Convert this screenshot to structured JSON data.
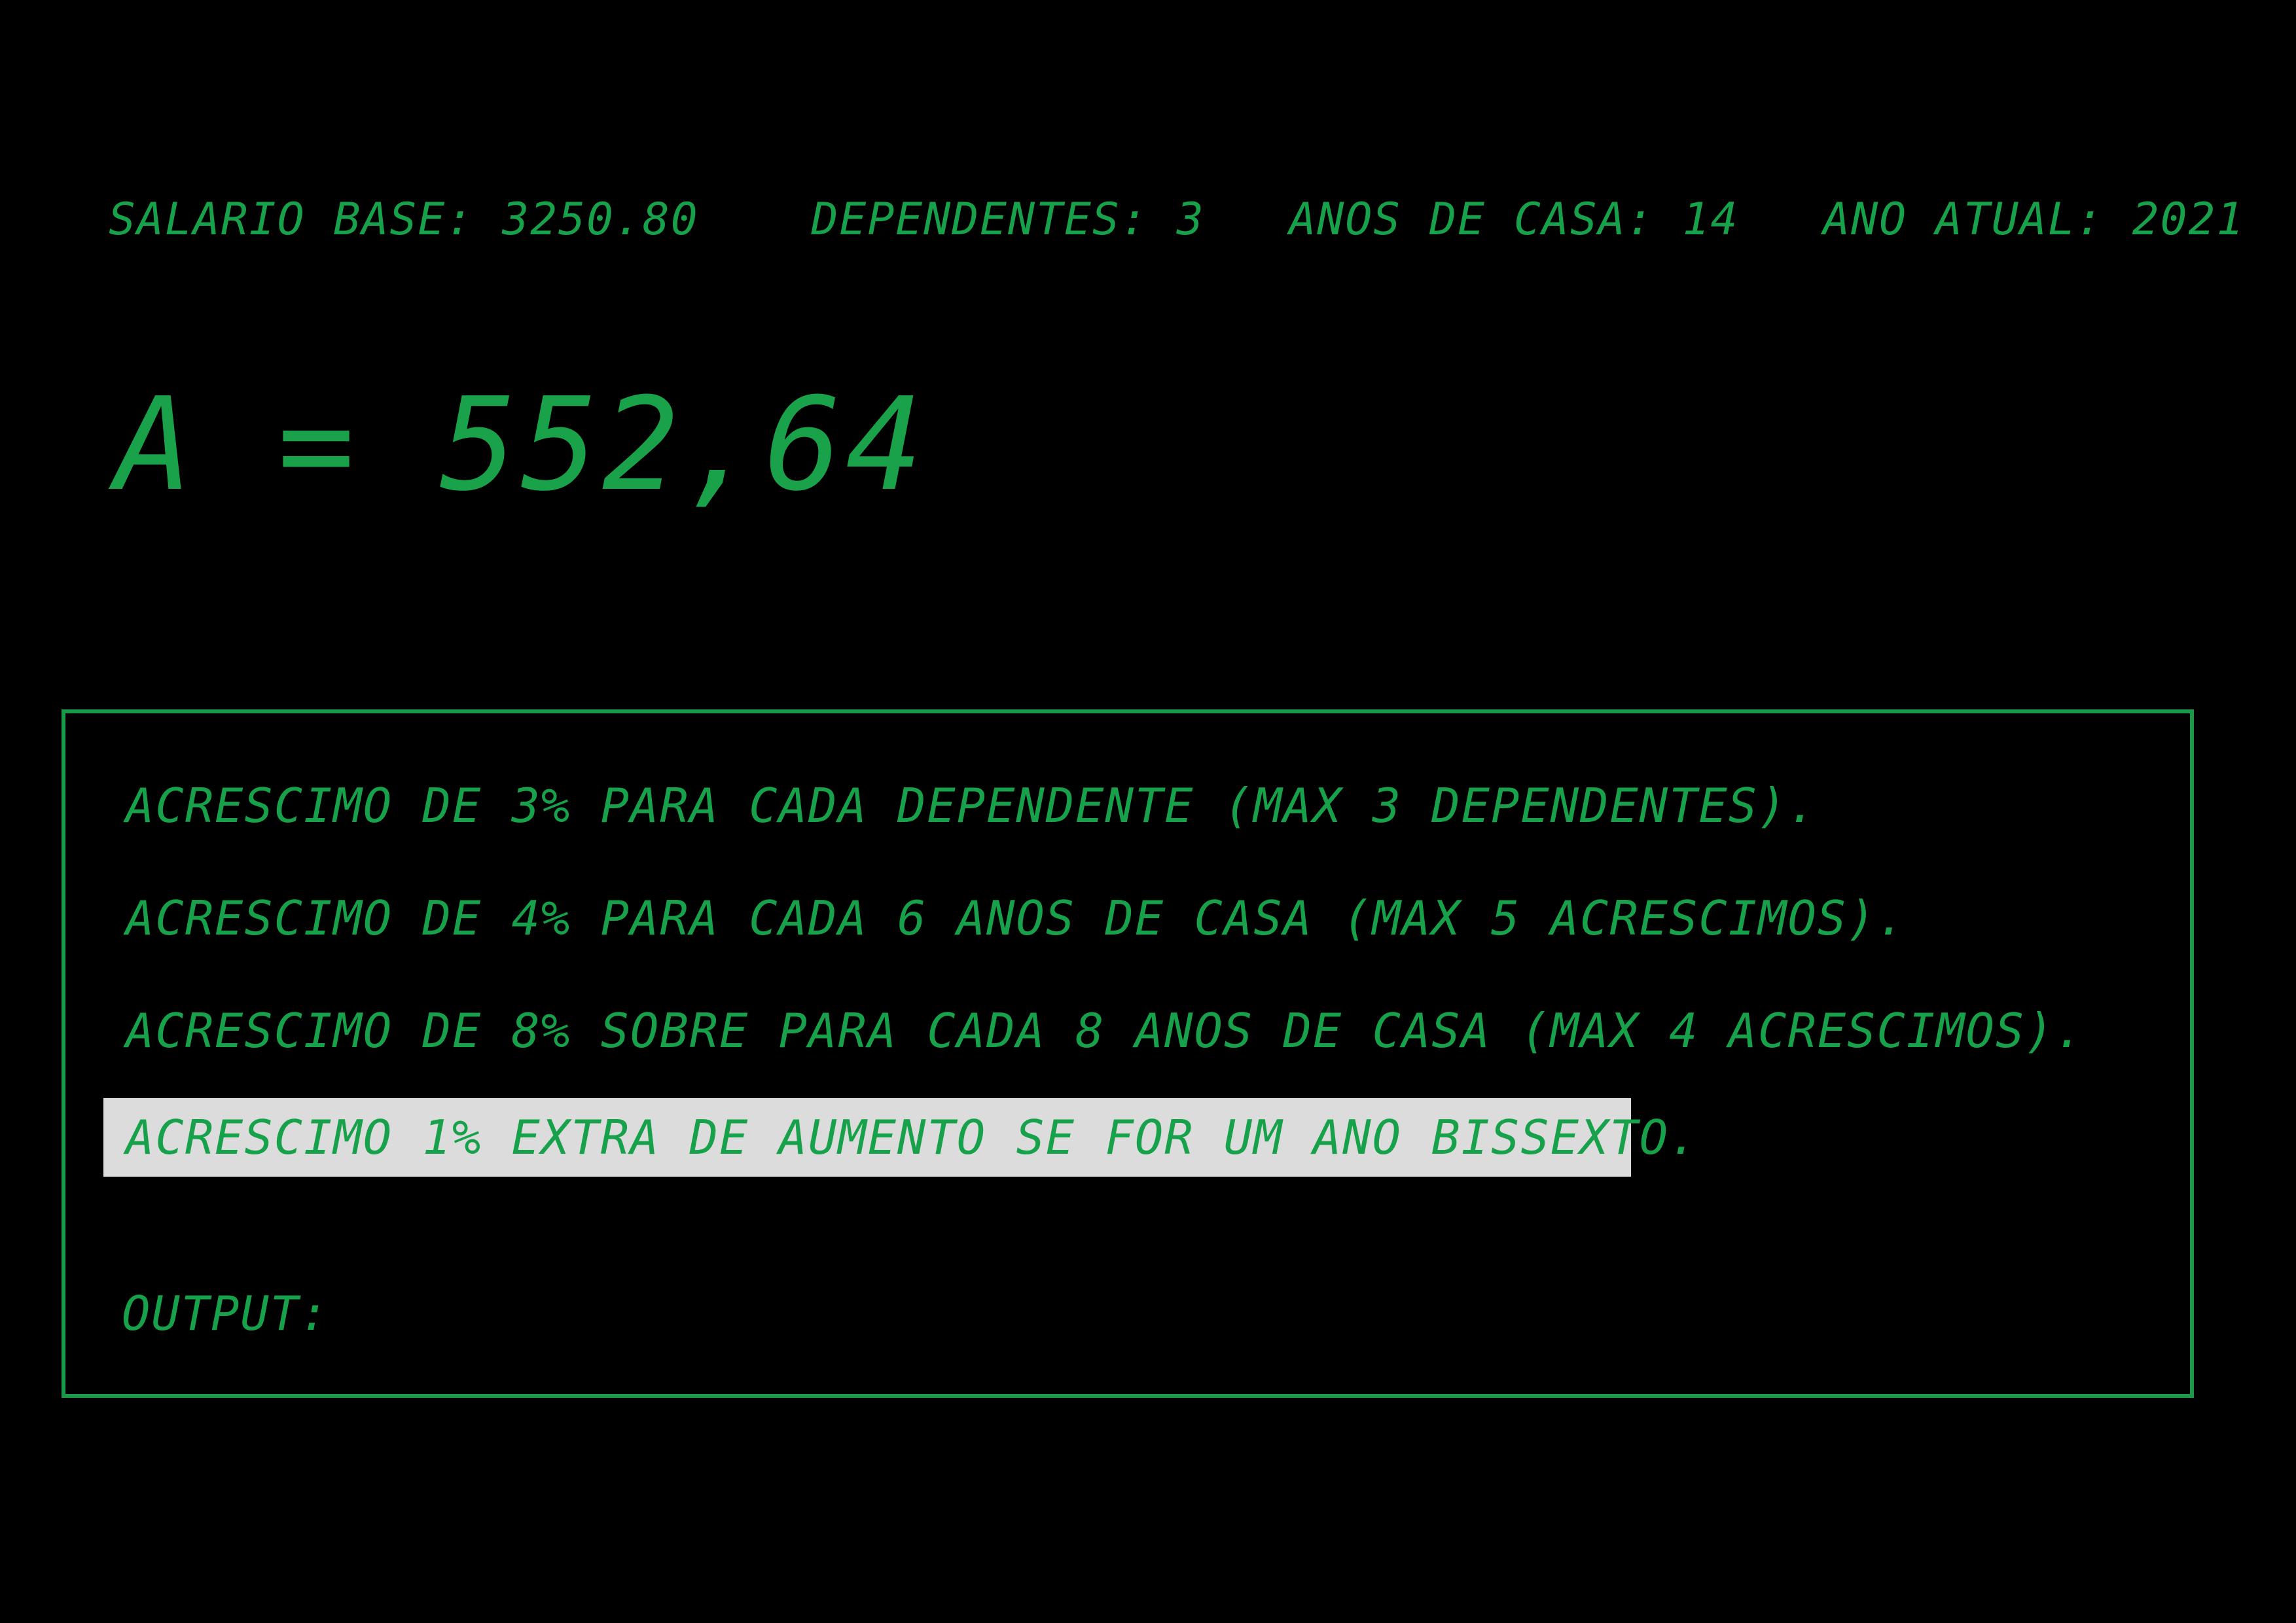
{
  "header": {
    "text": "SALARIO BASE: 3250.80    DEPENDENTES: 3   ANOS DE CASA: 14   ANO ATUAL: 2021"
  },
  "result": {
    "text": "A = 552,64"
  },
  "rules": [
    {
      "text": "ACRESCIMO DE 3% PARA CADA DEPENDENTE (MAX 3 DEPENDENTES)."
    },
    {
      "text": "ACRESCIMO DE 4% PARA CADA 6 ANOS DE CASA (MAX 5 ACRESCIMOS)."
    },
    {
      "text": "ACRESCIMO DE 8% SOBRE PARA CADA 8 ANOS DE CASA (MAX 4 ACRESCIMOS)."
    },
    {
      "text": "ACRESCIMO 1% EXTRA DE AUMENTO SE FOR UM ANO BISSEXTO.",
      "highlighted": true
    }
  ],
  "output": {
    "label": "OUTPUT:"
  },
  "colors": {
    "background": "#000000",
    "text": "#17a14a",
    "border": "#1a9a48",
    "highlight": "#dcdcdc"
  }
}
